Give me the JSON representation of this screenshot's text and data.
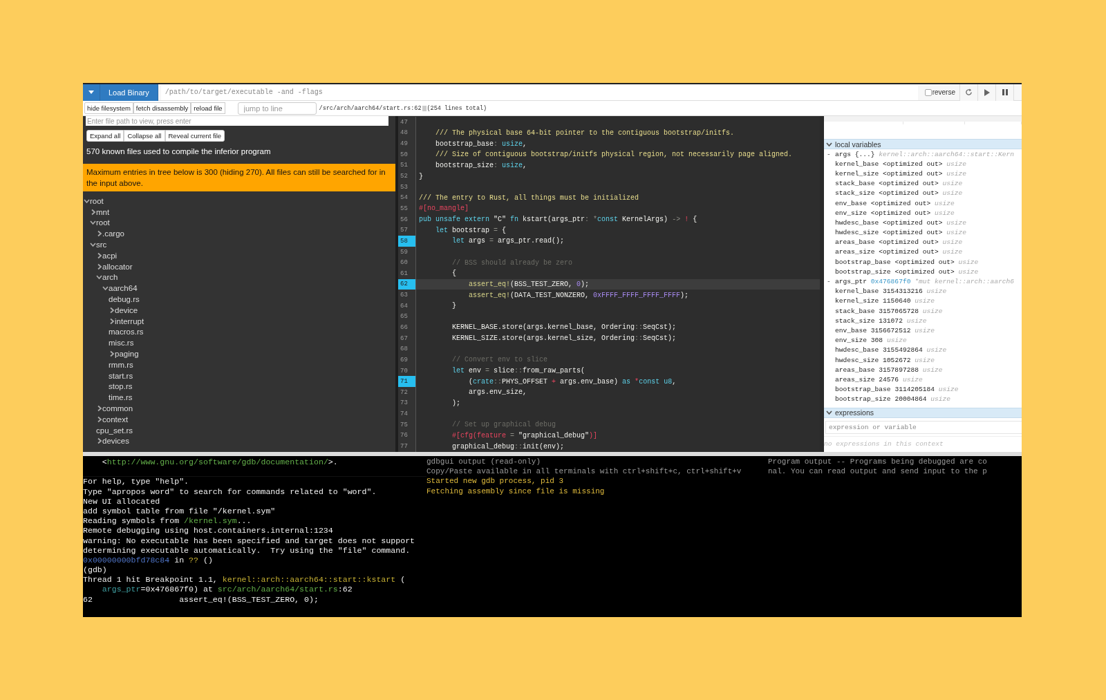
{
  "toolbar": {
    "load_button": "Load Binary",
    "binary_placeholder": "/path/to/target/executable -and -flags",
    "reverse": {
      "label": "reverse",
      "checked": false
    }
  },
  "source_bar": {
    "buttons": [
      "hide filesystem",
      "fetch disassembly",
      "reload file"
    ],
    "jump_placeholder": "jump to line",
    "path": "/src/arch/aarch64/start.rs:62",
    "total": "(254 lines total)"
  },
  "file_panel": {
    "path_placeholder": "Enter file path to view, press enter",
    "buttons": [
      "Expand all",
      "Collapse all",
      "Reveal current file"
    ],
    "summary": "570 known files used to compile the inferior program",
    "warning": "Maximum entries in tree below is 300 (hiding 270). All files can still be searched for in the input above."
  },
  "tree": [
    {
      "name": "root",
      "kind": "folder",
      "expanded": true,
      "children": [
        {
          "name": "mnt",
          "kind": "folder",
          "expanded": false
        },
        {
          "name": "root",
          "kind": "folder",
          "expanded": true,
          "children": [
            {
              "name": ".cargo",
              "kind": "folder",
              "expanded": false
            }
          ]
        },
        {
          "name": "src",
          "kind": "folder",
          "expanded": true,
          "children": [
            {
              "name": "acpi",
              "kind": "folder",
              "expanded": false
            },
            {
              "name": "allocator",
              "kind": "folder",
              "expanded": false
            },
            {
              "name": "arch",
              "kind": "folder",
              "expanded": true,
              "children": [
                {
                  "name": "aarch64",
                  "kind": "folder",
                  "expanded": true,
                  "children": [
                    {
                      "name": "debug.rs",
                      "kind": "file"
                    },
                    {
                      "name": "device",
                      "kind": "folder",
                      "expanded": false
                    },
                    {
                      "name": "interrupt",
                      "kind": "folder",
                      "expanded": false
                    },
                    {
                      "name": "macros.rs",
                      "kind": "file"
                    },
                    {
                      "name": "misc.rs",
                      "kind": "file"
                    },
                    {
                      "name": "paging",
                      "kind": "folder",
                      "expanded": false
                    },
                    {
                      "name": "rmm.rs",
                      "kind": "file"
                    },
                    {
                      "name": "start.rs",
                      "kind": "file"
                    },
                    {
                      "name": "stop.rs",
                      "kind": "file"
                    },
                    {
                      "name": "time.rs",
                      "kind": "file"
                    }
                  ]
                }
              ]
            },
            {
              "name": "common",
              "kind": "folder",
              "expanded": false
            },
            {
              "name": "context",
              "kind": "folder",
              "expanded": false
            },
            {
              "name": "cpu_set.rs",
              "kind": "file"
            },
            {
              "name": "devices",
              "kind": "folder",
              "expanded": false
            }
          ]
        }
      ]
    }
  ],
  "code": [
    {
      "number": "47",
      "breakpoint": false,
      "current": false
    },
    {
      "number": "48",
      "breakpoint": false,
      "current": false,
      "tokens": [
        {
          "kind": "doc",
          "text": "    /// The physical base 64-bit pointer to the contiguous bootstrap/initfs."
        }
      ]
    },
    {
      "number": "49",
      "breakpoint": false,
      "current": false,
      "tokens": [
        {
          "kind": "text",
          "text": "    bootstrap_base"
        },
        {
          "kind": "op",
          "text": ": "
        },
        {
          "kind": "kw",
          "text": "usize"
        },
        {
          "kind": "text",
          "text": ","
        }
      ]
    },
    {
      "number": "50",
      "breakpoint": false,
      "current": false,
      "tokens": [
        {
          "kind": "doc",
          "text": "    /// Size of contiguous bootstrap/initfs physical region, not necessarily page aligned."
        }
      ]
    },
    {
      "number": "51",
      "breakpoint": false,
      "current": false,
      "tokens": [
        {
          "kind": "text",
          "text": "    bootstrap_size"
        },
        {
          "kind": "op",
          "text": ": "
        },
        {
          "kind": "kw",
          "text": "usize"
        },
        {
          "kind": "text",
          "text": ","
        }
      ]
    },
    {
      "number": "52",
      "breakpoint": false,
      "current": false,
      "tokens": [
        {
          "kind": "text",
          "text": "}"
        }
      ]
    },
    {
      "number": "53",
      "breakpoint": false,
      "current": false
    },
    {
      "number": "54",
      "breakpoint": false,
      "current": false,
      "tokens": [
        {
          "kind": "doc",
          "text": "/// The entry to Rust, all things must be initialized"
        }
      ]
    },
    {
      "number": "55",
      "breakpoint": false,
      "current": false,
      "tokens": [
        {
          "kind": "attr",
          "text": "#[no_mangle]"
        }
      ]
    },
    {
      "number": "56",
      "breakpoint": false,
      "current": false,
      "tokens": [
        {
          "kind": "kw",
          "text": "pub unsafe extern"
        },
        {
          "kind": "text",
          "text": " \"C\" "
        },
        {
          "kind": "kw",
          "text": "fn"
        },
        {
          "kind": "text",
          "text": " kstart(args_ptr"
        },
        {
          "kind": "op",
          "text": ": *"
        },
        {
          "kind": "kw",
          "text": "const"
        },
        {
          "kind": "text",
          "text": " KernelArgs) "
        },
        {
          "kind": "op",
          "text": "->"
        },
        {
          "kind": "attr",
          "text": " !"
        },
        {
          "kind": "text",
          "text": " {"
        }
      ]
    },
    {
      "number": "57",
      "breakpoint": false,
      "current": false,
      "tokens": [
        {
          "kind": "kw",
          "text": "    let"
        },
        {
          "kind": "text",
          "text": " bootstrap "
        },
        {
          "kind": "op",
          "text": "="
        },
        {
          "kind": "text",
          "text": " {"
        }
      ]
    },
    {
      "number": "58",
      "breakpoint": true,
      "current": false,
      "tokens": [
        {
          "kind": "kw",
          "text": "        let"
        },
        {
          "kind": "text",
          "text": " args "
        },
        {
          "kind": "op",
          "text": "="
        },
        {
          "kind": "text",
          "text": " args_ptr.read();"
        }
      ]
    },
    {
      "number": "59",
      "breakpoint": false,
      "current": false
    },
    {
      "number": "60",
      "breakpoint": false,
      "current": false,
      "tokens": [
        {
          "kind": "cmt",
          "text": "        // BSS should already be zero"
        }
      ]
    },
    {
      "number": "61",
      "breakpoint": false,
      "current": false,
      "tokens": [
        {
          "kind": "text",
          "text": "        {"
        }
      ]
    },
    {
      "number": "62",
      "breakpoint": true,
      "current": true,
      "tokens": [
        {
          "kind": "macro",
          "text": "            assert_eq!"
        },
        {
          "kind": "text",
          "text": "(BSS_TEST_ZERO, "
        },
        {
          "kind": "num",
          "text": "0"
        },
        {
          "kind": "text",
          "text": ");"
        }
      ]
    },
    {
      "number": "63",
      "breakpoint": false,
      "current": false,
      "tokens": [
        {
          "kind": "macro",
          "text": "            assert_eq!"
        },
        {
          "kind": "text",
          "text": "(DATA_TEST_NONZERO, "
        },
        {
          "kind": "num",
          "text": "0xFFFF_FFFF_FFFF_FFFF"
        },
        {
          "kind": "text",
          "text": ");"
        }
      ]
    },
    {
      "number": "64",
      "breakpoint": false,
      "current": false,
      "tokens": [
        {
          "kind": "text",
          "text": "        }"
        }
      ]
    },
    {
      "number": "65",
      "breakpoint": false,
      "current": false
    },
    {
      "number": "66",
      "breakpoint": false,
      "current": false,
      "tokens": [
        {
          "kind": "text",
          "text": "        KERNEL_BASE.store(args.kernel_base, Ordering"
        },
        {
          "kind": "op",
          "text": "::"
        },
        {
          "kind": "text",
          "text": "SeqCst);"
        }
      ]
    },
    {
      "number": "67",
      "breakpoint": false,
      "current": false,
      "tokens": [
        {
          "kind": "text",
          "text": "        KERNEL_SIZE.store(args.kernel_size, Ordering"
        },
        {
          "kind": "op",
          "text": "::"
        },
        {
          "kind": "text",
          "text": "SeqCst);"
        }
      ]
    },
    {
      "number": "68",
      "breakpoint": false,
      "current": false
    },
    {
      "number": "69",
      "breakpoint": false,
      "current": false,
      "tokens": [
        {
          "kind": "cmt",
          "text": "        // Convert env to slice"
        }
      ]
    },
    {
      "number": "70",
      "breakpoint": false,
      "current": false,
      "tokens": [
        {
          "kind": "kw",
          "text": "        let"
        },
        {
          "kind": "text",
          "text": " env "
        },
        {
          "kind": "op",
          "text": "="
        },
        {
          "kind": "text",
          "text": " slice"
        },
        {
          "kind": "op",
          "text": "::"
        },
        {
          "kind": "text",
          "text": "from_raw_parts("
        }
      ]
    },
    {
      "number": "71",
      "breakpoint": true,
      "current": false,
      "tokens": [
        {
          "kind": "text",
          "text": "            ("
        },
        {
          "kind": "kw",
          "text": "crate"
        },
        {
          "kind": "op",
          "text": "::"
        },
        {
          "kind": "text",
          "text": "PHYS_OFFSET "
        },
        {
          "kind": "attr",
          "text": "+"
        },
        {
          "kind": "text",
          "text": " args.env_base) "
        },
        {
          "kind": "kw",
          "text": "as"
        },
        {
          "kind": "attr",
          "text": " *"
        },
        {
          "kind": "kw",
          "text": "const u8"
        },
        {
          "kind": "text",
          "text": ","
        }
      ]
    },
    {
      "number": "72",
      "breakpoint": false,
      "current": false,
      "tokens": [
        {
          "kind": "text",
          "text": "            args.env_size,"
        }
      ]
    },
    {
      "number": "73",
      "breakpoint": false,
      "current": false,
      "tokens": [
        {
          "kind": "text",
          "text": "        );"
        }
      ]
    },
    {
      "number": "74",
      "breakpoint": false,
      "current": false
    },
    {
      "number": "75",
      "breakpoint": false,
      "current": false,
      "tokens": [
        {
          "kind": "cmt",
          "text": "        // Set up graphical debug"
        }
      ]
    },
    {
      "number": "76",
      "breakpoint": false,
      "current": false,
      "tokens": [
        {
          "kind": "attr",
          "text": "        #[cfg(feature "
        },
        {
          "kind": "op",
          "text": "="
        },
        {
          "kind": "text",
          "text": " \"graphical_debug\""
        },
        {
          "kind": "attr",
          "text": ")]"
        }
      ]
    },
    {
      "number": "77",
      "breakpoint": false,
      "current": false,
      "tokens": [
        {
          "kind": "text",
          "text": "        graphical_debug"
        },
        {
          "kind": "op",
          "text": "::"
        },
        {
          "kind": "text",
          "text": "init(env);"
        }
      ]
    }
  ],
  "locals": {
    "title": "local variables",
    "expanded": true,
    "groups": [
      {
        "name": "args",
        "toggle": "-",
        "value": "{...}",
        "kind": "struct",
        "type": "kernel::arch::aarch64::start::Kern",
        "expanded": true,
        "fields": [
          {
            "name": "kernel_base",
            "value": "<optimized out>",
            "type": "usize"
          },
          {
            "name": "kernel_size",
            "value": "<optimized out>",
            "type": "usize"
          },
          {
            "name": "stack_base",
            "value": "<optimized out>",
            "type": "usize"
          },
          {
            "name": "stack_size",
            "value": "<optimized out>",
            "type": "usize"
          },
          {
            "name": "env_base",
            "value": "<optimized out>",
            "type": "usize"
          },
          {
            "name": "env_size",
            "value": "<optimized out>",
            "type": "usize"
          },
          {
            "name": "hwdesc_base",
            "value": "<optimized out>",
            "type": "usize"
          },
          {
            "name": "hwdesc_size",
            "value": "<optimized out>",
            "type": "usize"
          },
          {
            "name": "areas_base",
            "value": "<optimized out>",
            "type": "usize"
          },
          {
            "name": "areas_size",
            "value": "<optimized out>",
            "type": "usize"
          },
          {
            "name": "bootstrap_base",
            "value": "<optimized out>",
            "type": "usize"
          },
          {
            "name": "bootstrap_size",
            "value": "<optimized out>",
            "type": "usize"
          }
        ]
      },
      {
        "name": "args_ptr",
        "toggle": "-",
        "value": "0x476867f0",
        "kind": "pointer",
        "type": "*mut kernel::arch::aarch6",
        "expanded": true,
        "fields": [
          {
            "name": "kernel_base",
            "value": "3154313216",
            "type": "usize"
          },
          {
            "name": "kernel_size",
            "value": "1150640",
            "type": "usize"
          },
          {
            "name": "stack_base",
            "value": "3157065728",
            "type": "usize"
          },
          {
            "name": "stack_size",
            "value": "131072",
            "type": "usize"
          },
          {
            "name": "env_base",
            "value": "3156672512",
            "type": "usize"
          },
          {
            "name": "env_size",
            "value": "308",
            "type": "usize"
          },
          {
            "name": "hwdesc_base",
            "value": "3155492864",
            "type": "usize"
          },
          {
            "name": "hwdesc_size",
            "value": "1052672",
            "type": "usize"
          },
          {
            "name": "areas_base",
            "value": "3157897288",
            "type": "usize"
          },
          {
            "name": "areas_size",
            "value": "24576",
            "type": "usize"
          },
          {
            "name": "bootstrap_base",
            "value": "3114205184",
            "type": "usize"
          },
          {
            "name": "bootstrap_size",
            "value": "20004864",
            "type": "usize"
          }
        ]
      }
    ]
  },
  "expressions": {
    "title": "expressions",
    "expanded": true,
    "placeholder": "expression or variable",
    "empty_note": "no expressions in this context"
  },
  "gdb_terminal": [
    {
      "segments": [
        {
          "kind": "text",
          "text": "    <"
        },
        {
          "kind": "link",
          "text": "http://www.gnu.org/software/gdb/documentation/"
        },
        {
          "kind": "text",
          "text": ">."
        }
      ],
      "gap_after": true
    },
    {
      "segments": [
        {
          "kind": "text",
          "text": "For help, type \"help\"."
        }
      ]
    },
    {
      "segments": [
        {
          "kind": "text",
          "text": "Type \"apropos word\" to search for commands related to \"word\"."
        }
      ]
    },
    {
      "segments": [
        {
          "kind": "text",
          "text": "New UI allocated"
        }
      ]
    },
    {
      "segments": [
        {
          "kind": "text",
          "text": "add symbol table from file \"/kernel.sym\""
        }
      ]
    },
    {
      "segments": [
        {
          "kind": "text",
          "text": "Reading symbols from "
        },
        {
          "kind": "link",
          "text": "/kernel.sym"
        },
        {
          "kind": "text",
          "text": "..."
        }
      ]
    },
    {
      "segments": [
        {
          "kind": "text",
          "text": "Remote debugging using host.containers.internal:1234"
        }
      ]
    },
    {
      "segments": [
        {
          "kind": "text",
          "text": "warning: No executable has been specified and target does not support"
        }
      ]
    },
    {
      "segments": [
        {
          "kind": "text",
          "text": "determining executable automatically.  Try using the \"file\" command."
        }
      ]
    },
    {
      "segments": [
        {
          "kind": "addr",
          "text": "0x00000000bfd78c84"
        },
        {
          "kind": "text",
          "text": " in "
        },
        {
          "kind": "func",
          "text": "??"
        },
        {
          "kind": "text",
          "text": " ()"
        }
      ]
    },
    {
      "segments": [
        {
          "kind": "text",
          "text": "(gdb)"
        }
      ]
    },
    {
      "segments": [
        {
          "kind": "text",
          "text": "Thread 1 hit Breakpoint 1.1, "
        },
        {
          "kind": "func",
          "text": "kernel::arch::aarch64::start::kstart"
        },
        {
          "kind": "text",
          "text": " ("
        }
      ]
    },
    {
      "segments": [
        {
          "kind": "arg",
          "text": "    args_ptr"
        },
        {
          "kind": "text",
          "text": "=0x476867f0) at "
        },
        {
          "kind": "link",
          "text": "src/arch/aarch64/start.rs"
        },
        {
          "kind": "text",
          "text": ":62"
        }
      ]
    },
    {
      "segments": [
        {
          "kind": "text",
          "text": "62                  assert_eq!(BSS_TEST_ZERO, 0);"
        }
      ]
    }
  ],
  "gdbgui_output": [
    {
      "kind": "info",
      "text": "gdbgui output (read-only)"
    },
    {
      "kind": "info",
      "text": "Copy/Paste available in all terminals with ctrl+shift+c, ctrl+shift+v"
    },
    {
      "kind": "status",
      "text": "Started new gdb process, pid 3"
    },
    {
      "kind": "status",
      "text": "Fetching assembly since file is missing"
    }
  ],
  "program_output": [
    "Program output -- Programs being debugged are co",
    "nal. You can read output and send input to the p"
  ]
}
